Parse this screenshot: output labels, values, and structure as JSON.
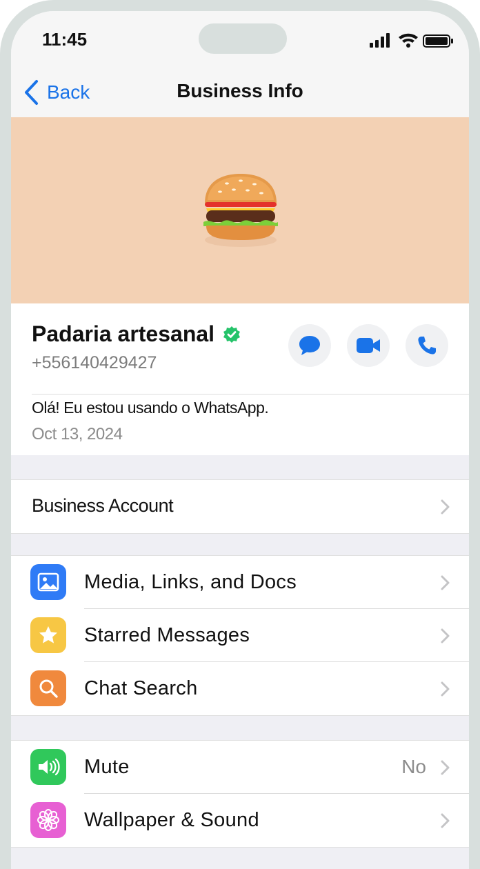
{
  "status": {
    "time": "11:45"
  },
  "nav": {
    "back_label": "Back",
    "title": "Business Info"
  },
  "hero": {
    "image": "hamburger-emoji",
    "background": "#f3d1b4"
  },
  "profile": {
    "name": "Padaria artesanal",
    "verified_icon": "verified-badge-icon",
    "phone": "+556140429427",
    "about": "Olá! Eu estou usando o WhatsApp.",
    "date": "Oct 13, 2024",
    "actions": [
      "message-icon",
      "video-call-icon",
      "voice-call-icon"
    ]
  },
  "business_account": {
    "label": "Business Account"
  },
  "media_section": {
    "items": [
      {
        "label": "Media, Links, and Docs",
        "icon": "image-icon",
        "color": "#2f7bf6"
      },
      {
        "label": "Starred Messages",
        "icon": "star-icon",
        "color": "#f7c744"
      },
      {
        "label": "Chat Search",
        "icon": "search-icon",
        "color": "#f0893d"
      }
    ]
  },
  "settings_section": {
    "items": [
      {
        "label": "Mute",
        "value": "No",
        "icon": "speaker-icon",
        "color": "#30c85b"
      },
      {
        "label": "Wallpaper & Sound",
        "icon": "flower-icon",
        "color": "#e760d3"
      }
    ]
  },
  "colors": {
    "accent": "#1a73e8",
    "verified": "#25c36a"
  }
}
